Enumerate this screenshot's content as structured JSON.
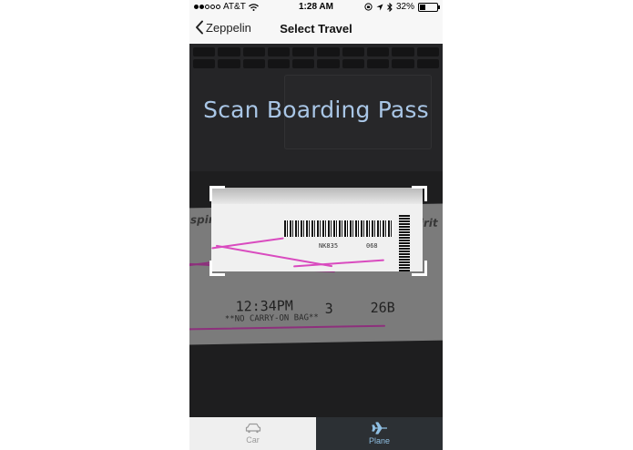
{
  "status_bar": {
    "carrier": "AT&T",
    "time": "1:28 AM",
    "battery": "32%",
    "battery_level": 0.32,
    "signal_bars": 5,
    "signal_filled": 2
  },
  "nav": {
    "back_label": "Zeppelin",
    "title": "Select Travel"
  },
  "scanner": {
    "title": "Scan Boarding Pass"
  },
  "tabs": [
    {
      "label": "Car",
      "icon": "car-icon",
      "selected": false
    },
    {
      "label": "Plane",
      "icon": "plane-icon",
      "selected": true
    }
  ],
  "colors": {
    "scan_title": "#a9c6e6",
    "plane_tab_bg": "#2c3034",
    "plane_tab_accent": "#8fbfe3",
    "car_tab_text": "#9a9a9a"
  }
}
